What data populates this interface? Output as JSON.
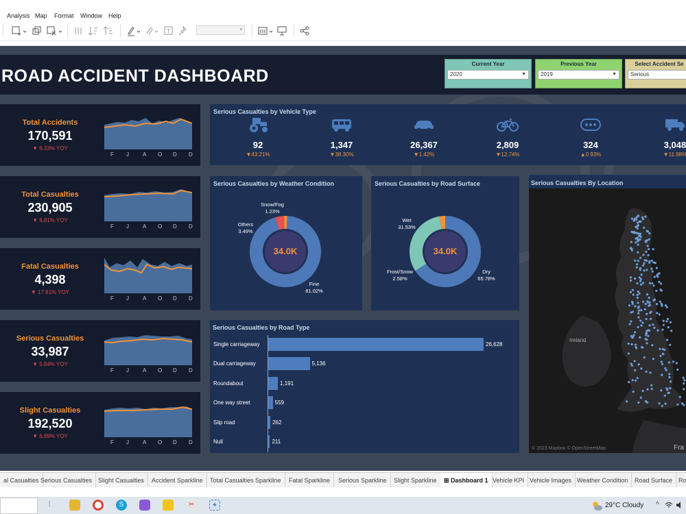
{
  "menu": [
    "Analysis",
    "Map",
    "Format",
    "Window",
    "Help"
  ],
  "dashboard": {
    "title": "ROAD ACCIDENT DASHBOARD",
    "filters": [
      {
        "label": "Current Year",
        "value": "2020",
        "color": "#7fc6b6"
      },
      {
        "label": "Previous Year",
        "value": "2019",
        "color": "#8fd36f"
      },
      {
        "label": "Select Accident Se",
        "value": "Serious",
        "color": "#d9cf9b"
      }
    ],
    "months": [
      "F",
      "J",
      "A",
      "O",
      "D"
    ],
    "kpis": [
      {
        "label": "Total Accidents",
        "value": "170,591",
        "yoy": "▼ 6.33% YOY"
      },
      {
        "label": "Total Casualties",
        "value": "230,905",
        "yoy": "▼ 6.81% YOY"
      },
      {
        "label": "Fatal Casualties",
        "value": "4,398",
        "yoy": "▼ 17.81% YOY"
      },
      {
        "label": "Serious Casualties",
        "value": "33,987",
        "yoy": "▼ 5.84% YOY"
      },
      {
        "label": "Slight Casualties",
        "value": "192,520",
        "yoy": "▼ 6.69% YOY"
      }
    ],
    "vehicle_panel": {
      "title": "Serious Casualties by Vehicle Type",
      "items": [
        {
          "icon": "tractor-icon",
          "value": "92",
          "pct": "▼43.21%"
        },
        {
          "icon": "bus-icon",
          "value": "1,347",
          "pct": "▼38.30%"
        },
        {
          "icon": "car-icon",
          "value": "26,367",
          "pct": "▼1.42%"
        },
        {
          "icon": "bicycle-icon",
          "value": "2,809",
          "pct": "▼12.74%"
        },
        {
          "icon": "more-icon",
          "value": "324",
          "pct": "▲0.93%"
        },
        {
          "icon": "truck-icon",
          "value": "3,048",
          "pct": "▼11.98%"
        }
      ]
    },
    "weather_panel": {
      "title": "Serious Casualties by Weather Condition",
      "center": "34.0K",
      "labels": {
        "snow": "Snow/Fog",
        "snow_pct": "1.23%",
        "others": "Others",
        "others_pct": "3.49%",
        "fine": "Fine",
        "fine_pct": "81.02%"
      }
    },
    "surface_panel": {
      "title": "Serious Casualties by Road Surface",
      "center": "34.0K",
      "labels": {
        "wet": "Wet",
        "wet_pct": "31.53%",
        "frost": "Frost/Snow",
        "frost_pct": "2.58%",
        "dry": "Dry",
        "dry_pct": "65.78%"
      }
    },
    "road_type_panel": {
      "title": "Serious Casualties by Road Type"
    },
    "map_panel": {
      "title": "Serious Casualties By Location",
      "ireland": "Ireland",
      "france": "Fra",
      "credit": "© 2023 Mapbox © OpenStreetMap"
    }
  },
  "chart_data": [
    {
      "type": "bar",
      "title": "Serious Casualties by Road Type",
      "categories": [
        "Single carriageway",
        "Dual carriageway",
        "Roundabout",
        "One way street",
        "Slip road",
        "Null"
      ],
      "values": [
        26628,
        5136,
        1191,
        559,
        262,
        211
      ],
      "value_labels": [
        "26,628",
        "5,136",
        "1,191",
        "559",
        "262",
        "211"
      ],
      "orientation": "horizontal"
    },
    {
      "type": "pie",
      "title": "Serious Casualties by Weather Condition",
      "categories": [
        "Fine",
        "Others",
        "Snow/Fog"
      ],
      "values": [
        81.02,
        3.49,
        1.23
      ],
      "colors": [
        "#4d79b8",
        "#e3524f",
        "#f0933a"
      ]
    },
    {
      "type": "pie",
      "title": "Serious Casualties by Road Surface",
      "categories": [
        "Dry",
        "Wet",
        "Frost/Snow"
      ],
      "values": [
        65.78,
        31.53,
        2.58
      ],
      "colors": [
        "#4d79b8",
        "#7fc6b6",
        "#f0933a"
      ]
    }
  ],
  "tabs": [
    "al Casualties",
    "Serious Casualties",
    "Slight Casualties",
    "Accident Sparkline",
    "Total Casualties Sparkline",
    "Fatal Sparkline",
    "Serious Sparkline",
    "Slight Sparkline",
    "Dashboard 1",
    "Vehicle KPI",
    "Vehicle Images",
    "Weather Condition",
    "Road Surface",
    "Ro"
  ],
  "taskbar": {
    "weather": "29°C  Cloudy"
  }
}
